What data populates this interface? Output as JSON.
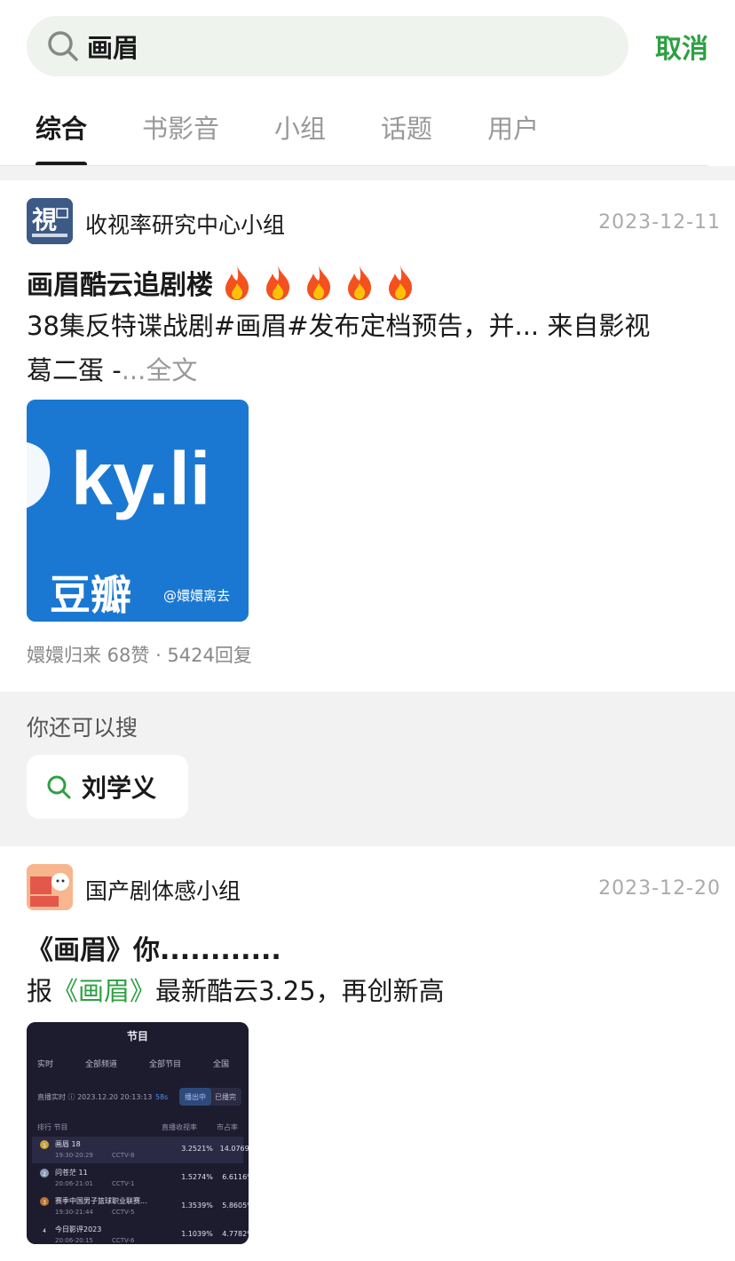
{
  "search": {
    "query": "画眉",
    "cancel_label": "取消"
  },
  "tabs": [
    {
      "label": "综合",
      "active": true
    },
    {
      "label": "书影音"
    },
    {
      "label": "小组"
    },
    {
      "label": "话题"
    },
    {
      "label": "用户"
    }
  ],
  "posts": [
    {
      "group": "收视率研究中心小组",
      "date": "2023-12-11",
      "title": "画眉酷云追剧楼",
      "body_line1": "38集反特谍战剧#画眉#发布定档预告，并... 来自影视",
      "body_line2": "葛二蛋 -",
      "fulltext_label": "...全文",
      "thumb": {
        "text": "ky.li",
        "brand": "豆瓣",
        "credit": "@嬛嬛离去"
      },
      "meta": "嬛嬛归来 68赞 · 5424回复"
    },
    {
      "group": "国产剧体感小组",
      "date": "2023-12-20",
      "title": "《画眉》你............",
      "body_prefix": "报",
      "body_highlight": "《画眉》",
      "body_suffix": "最新酷云3.25，再创新高",
      "thumb": {
        "header": "节目",
        "filters": [
          "实时",
          "全部频道",
          "全部节目",
          "全国"
        ],
        "live_label": "直播实时 ⓘ 2023.12.20 20:13:13",
        "refresh": "58s",
        "btn_on": "播出中",
        "btn_off": "已播完",
        "col_rank": "排行 节目",
        "col_rating": "直播收视率",
        "col_share": "市占率",
        "rows": [
          {
            "rank": "1",
            "name": "画眉 18",
            "time": "19:30-20:29",
            "channel": "CCTV-8",
            "rating": "3.2521%",
            "share": "14.0769%"
          },
          {
            "rank": "2",
            "name": "问苍茫 11",
            "time": "20:06-21:01",
            "channel": "CCTV-1",
            "rating": "1.5274%",
            "share": "6.6116%"
          },
          {
            "rank": "3",
            "name": "赛季中国男子篮球职业联赛...",
            "time": "19:30-21:44",
            "channel": "CCTV-5",
            "rating": "1.3539%",
            "share": "5.8605%"
          },
          {
            "rank": "4",
            "name": "今日影评2023",
            "time": "20:06-20:15",
            "channel": "CCTV-6",
            "rating": "1.1039%",
            "share": "4.7782%"
          }
        ]
      }
    }
  ],
  "suggest": {
    "label": "你还可以搜",
    "chip": "刘学义"
  },
  "colors": {
    "accent": "#2ea043",
    "search_bg": "#eef3ee",
    "gap": "#f2f2f2"
  }
}
